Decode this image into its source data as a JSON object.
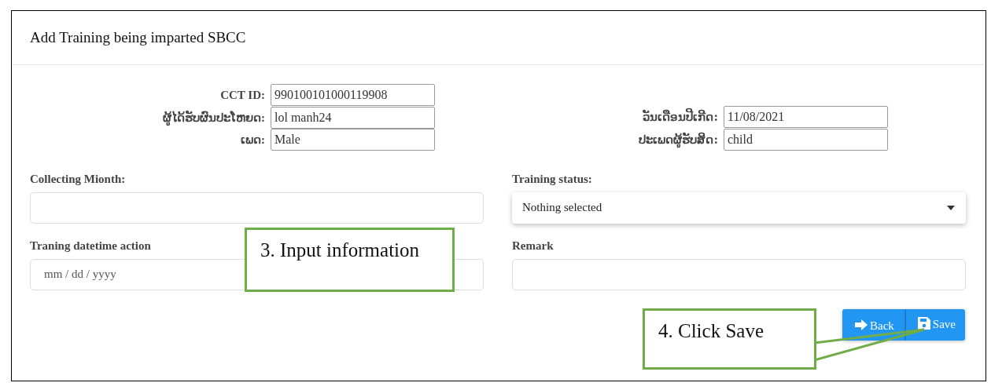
{
  "header": {
    "title": "Add Training being imparted SBCC"
  },
  "info": {
    "left": [
      {
        "label": "CCT ID:",
        "value": "990100101000119908"
      },
      {
        "label": "ຜູ້ໄດ້ຮັບຜົນປະໂຫຍດ:",
        "value": "lol manh24"
      },
      {
        "label": "ເພດ:",
        "value": "Male"
      }
    ],
    "right": [
      {
        "label": "ວັນເດືອນປີເກີດ:",
        "value": "11/08/2021"
      },
      {
        "label": "ປະເພດຜູ້ຮັບສິດ:",
        "value": "child"
      }
    ]
  },
  "fields": [
    {
      "kind": "text",
      "label": "Collecting Mionth:"
    },
    {
      "kind": "select",
      "label": "Training status:",
      "value": "Nothing selected"
    },
    {
      "kind": "date",
      "label": "Traning datetime action",
      "placeholder": "mm / dd / yyyy"
    },
    {
      "kind": "text",
      "label": "Remark"
    }
  ],
  "buttons": [
    {
      "kind": "back",
      "label": "Back"
    },
    {
      "kind": "save",
      "label": "Save"
    }
  ],
  "callouts": [
    {
      "kind": "box",
      "text": "3. Input information"
    },
    {
      "kind": "pointer",
      "text": "4. Click Save"
    }
  ]
}
